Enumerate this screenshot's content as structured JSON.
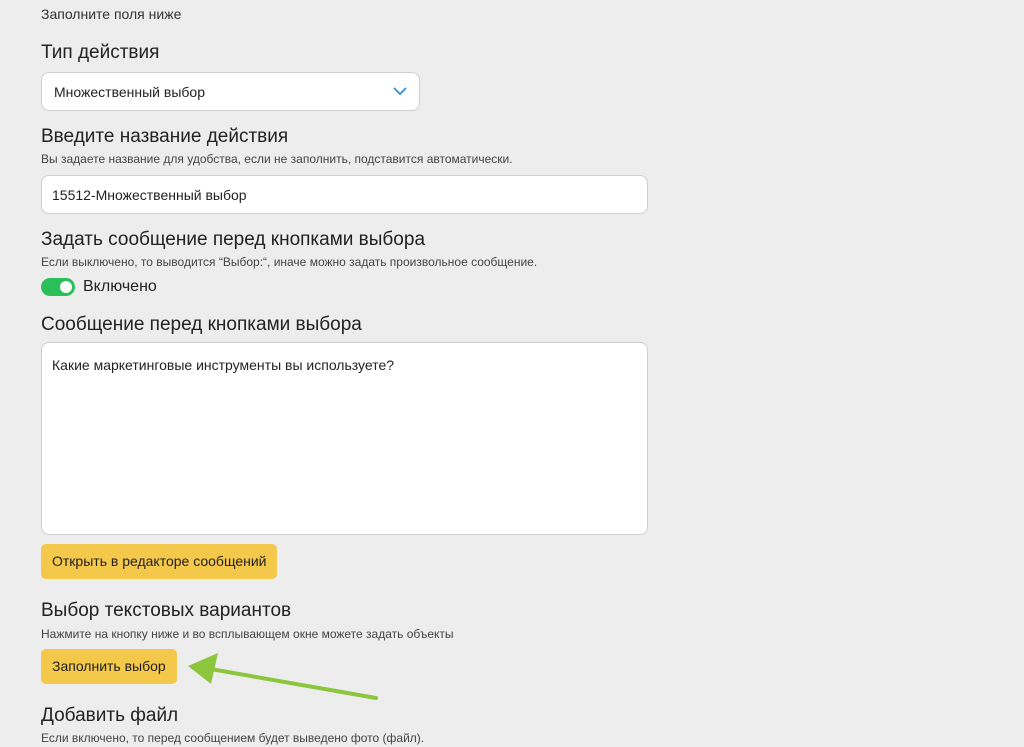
{
  "form": {
    "intro_hint": "Заполните поля ниже",
    "action_type": {
      "label": "Тип действия",
      "selected": "Множественный выбор"
    },
    "action_name": {
      "label": "Введите название действия",
      "description": "Вы задаете название для удобства, если не заполнить, подставится автоматически.",
      "value": "15512-Множественный выбор"
    },
    "message_before_buttons_toggle": {
      "label": "Задать сообщение перед кнопками выбора",
      "description": "Если выключено, то выводится “Выбор:“, иначе можно задать произвольное сообщение.",
      "state_label": "Включено",
      "enabled": true
    },
    "message_before_buttons": {
      "label": "Сообщение перед кнопками выбора",
      "value": "Какие маркетинговые инструменты вы используете?"
    },
    "open_editor_button": "Открыть в редакторе сообщений",
    "text_options": {
      "label": "Выбор текстовых вариантов",
      "description": "Нажмите на кнопку ниже и во всплывающем окне можете задать объекты",
      "fill_button": "Заполнить выбор"
    },
    "add_file": {
      "label": "Добавить файл",
      "description": "Если включено, то перед сообщением будет выведено фото (файл)."
    }
  },
  "colors": {
    "background": "#ededed",
    "button": "#f3c84b",
    "toggle_on": "#2bbf59",
    "annotation_arrow": "#8cc63f"
  },
  "icons": {
    "dropdown": "chevron-down-icon",
    "annotation": "arrow-pointer-icon"
  }
}
